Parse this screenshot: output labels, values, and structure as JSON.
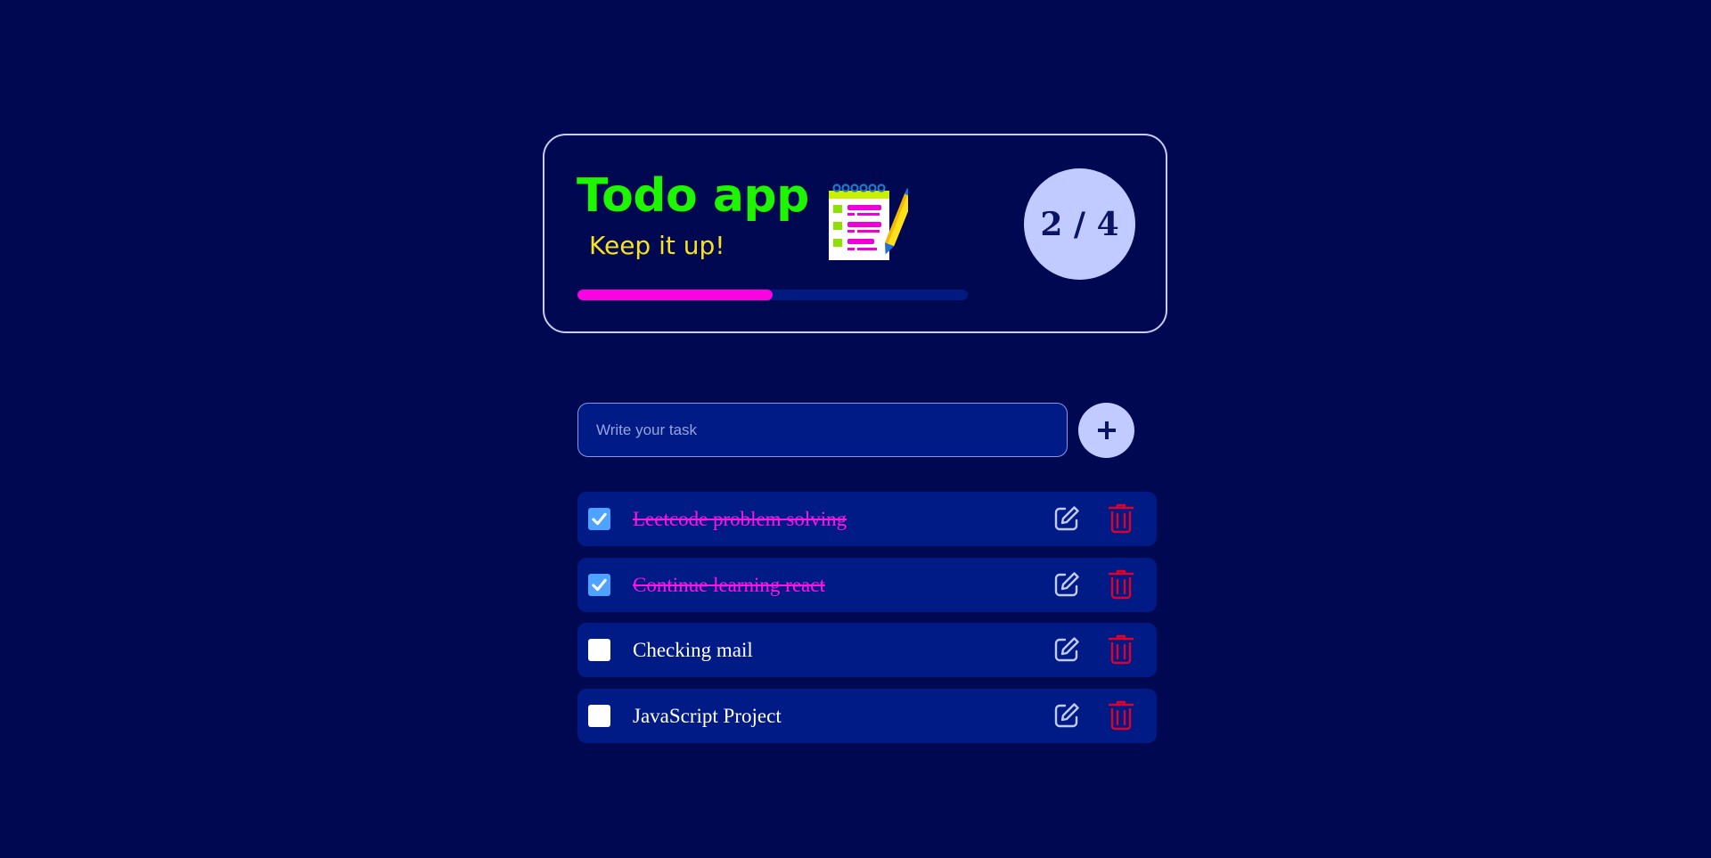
{
  "header": {
    "title": "Todo app",
    "subtitle": "Keep it up!",
    "icon": "notepad-pencil-icon",
    "counter_text": "2 / 4",
    "completed": 2,
    "total": 4,
    "progress_fraction": 0.5
  },
  "input": {
    "value": "",
    "placeholder": "Write your task"
  },
  "add_button": {
    "icon": "plus-icon"
  },
  "tasks": [
    {
      "text": "Leetcode problem solving",
      "done": true
    },
    {
      "text": "Continue learning react",
      "done": true
    },
    {
      "text": "Checking mail",
      "done": false
    },
    {
      "text": "JavaScript Project",
      "done": false
    }
  ],
  "task_icons": {
    "edit": "edit-icon",
    "delete": "trash-icon"
  },
  "colors": {
    "background": "#000852",
    "title": "#1ef500",
    "subtitle": "#f6e21e",
    "progress_fill": "#ff00e5",
    "progress_track": "#001a80",
    "done_text": "#ff14e6",
    "delete": "#e0002a",
    "accent_circle": "#c2cbff"
  }
}
